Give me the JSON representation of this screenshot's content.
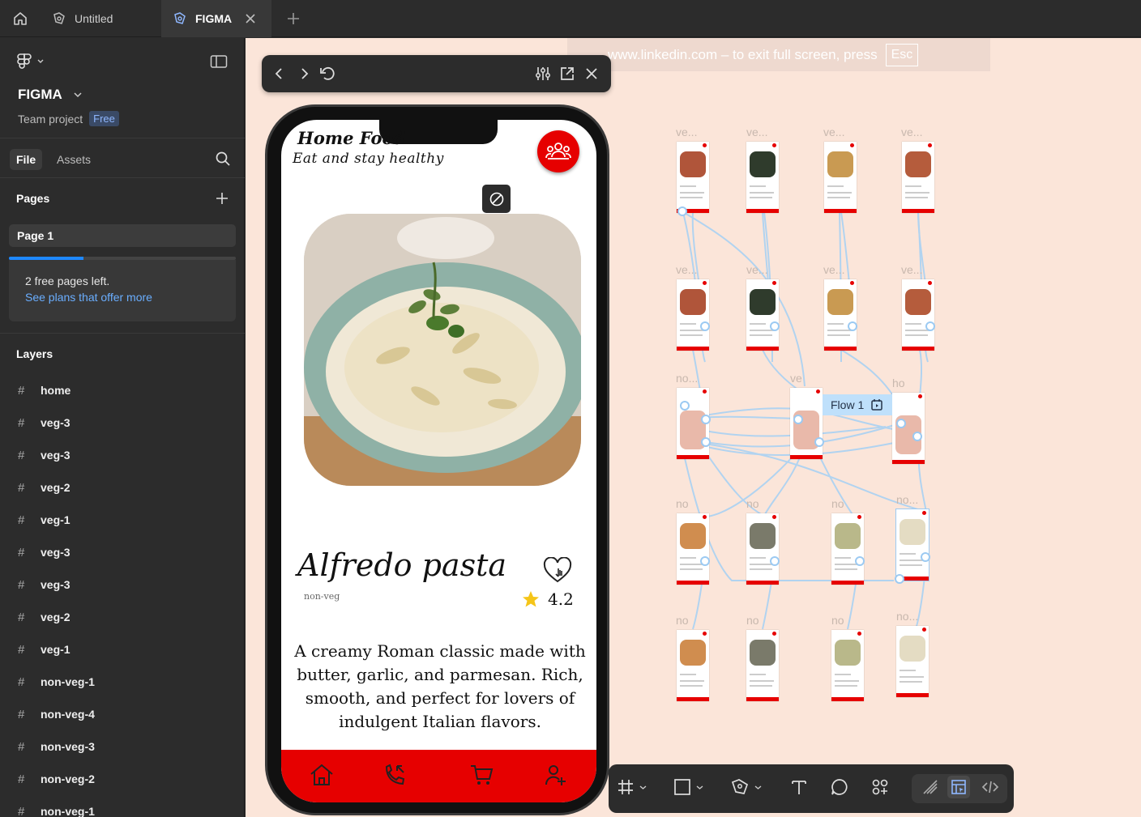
{
  "tabs": {
    "home_icon": "home-icon",
    "items": [
      {
        "label": "Untitled",
        "icon": "figma-file-icon"
      },
      {
        "label": "FIGMA",
        "icon": "figma-file-icon",
        "active": true
      }
    ]
  },
  "sidebar": {
    "project_name": "FIGMA",
    "project_type": "Team project",
    "plan_badge": "Free",
    "tabs": {
      "file": "File",
      "assets": "Assets"
    },
    "pages_heading": "Pages",
    "current_page": "Page 1",
    "promo": {
      "line1": "2 free pages left.",
      "link": "See plans that offer more"
    },
    "layers_heading": "Layers",
    "layers": [
      "home",
      "veg-3",
      "veg-3",
      "veg-2",
      "veg-1",
      "veg-3",
      "veg-3",
      "veg-2",
      "veg-1",
      "non-veg-1",
      "non-veg-4",
      "non-veg-3",
      "non-veg-2",
      "non-veg-1"
    ]
  },
  "canvas": {
    "fullscreen_notice": "www.linkedin.com – to exit full screen, press",
    "fullscreen_key": "Esc",
    "flow_label": "Flow 1",
    "frame_labels": [
      "ve...",
      "ve...",
      "ve...",
      "ve...",
      "ve...",
      "ve...",
      "ve...",
      "ve...",
      "no...",
      "ve",
      "ho",
      "no",
      "no",
      "no",
      "no...",
      "no",
      "no",
      "no",
      "no..."
    ]
  },
  "phone": {
    "app_title": "Home Food",
    "app_subtitle": "Eat and stay healthy",
    "dish_name": "Alfredo pasta",
    "dish_category": "non-veg",
    "rating": "4.2",
    "description": "A creamy Roman classic made with butter, garlic, and parmesan. Rich, smooth, and perfect for lovers of indulgent Italian flavors.",
    "nav_icons": [
      "home-icon",
      "phone-call-icon",
      "cart-icon",
      "user-add-icon"
    ]
  },
  "colors": {
    "brand_red": "#e60000",
    "canvas_bg": "#fbe5d9",
    "ui_dark": "#2c2c2c",
    "link_blue": "#6aaeff",
    "flow_blue": "#9ccaf2"
  }
}
